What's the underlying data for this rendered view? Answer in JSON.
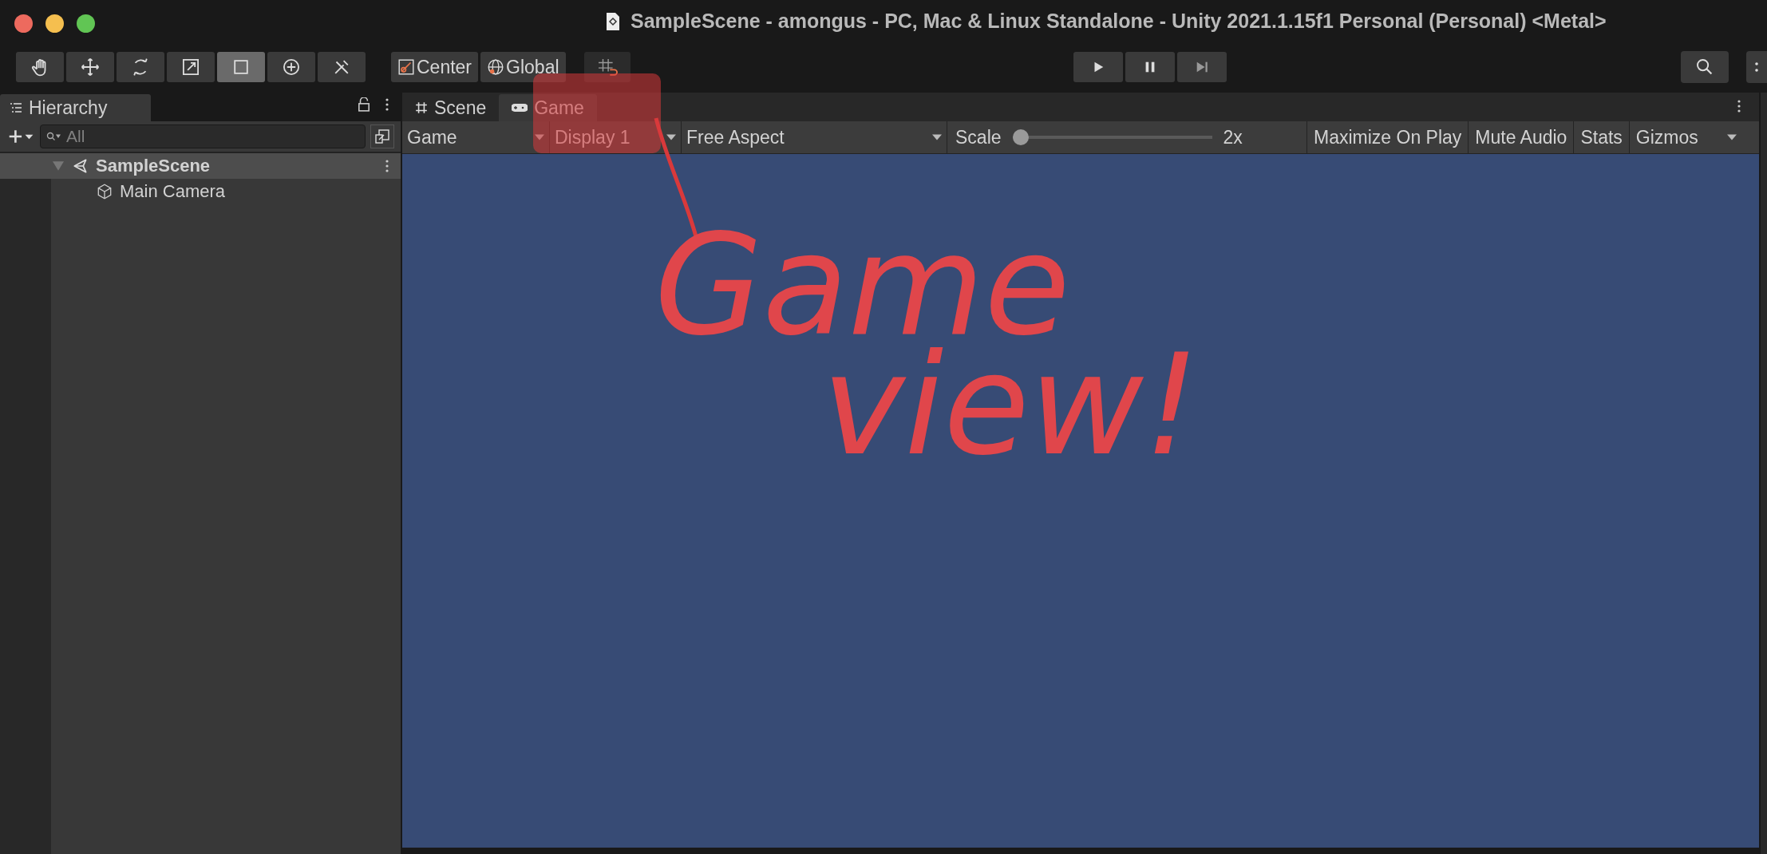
{
  "window": {
    "title": "SampleScene - amongus - PC, Mac & Linux Standalone - Unity 2021.1.15f1 Personal (Personal) <Metal>"
  },
  "tools": [
    {
      "kind": "hand",
      "selected": false
    },
    {
      "kind": "move",
      "selected": false
    },
    {
      "kind": "rotate",
      "selected": false
    },
    {
      "kind": "scale",
      "selected": false
    },
    {
      "kind": "rect",
      "selected": true
    },
    {
      "kind": "transform",
      "selected": false
    },
    {
      "kind": "custom",
      "selected": false
    }
  ],
  "pivot_buttons": [
    {
      "kind": "pivot",
      "label": "Center"
    },
    {
      "kind": "space",
      "label": "Global"
    }
  ],
  "hierarchy": {
    "tab": "Hierarchy",
    "search": {
      "placeholder": "All"
    },
    "tree": [
      {
        "label": "SampleScene",
        "kind": "scene",
        "expanded": true,
        "children": [
          {
            "label": "Main Camera",
            "kind": "object"
          }
        ]
      }
    ]
  },
  "view_tabs": [
    {
      "kind": "scene",
      "label": "Scene",
      "selected": false
    },
    {
      "kind": "game",
      "label": "Game",
      "selected": true
    }
  ],
  "game_toolbar": {
    "view_dropdown": "Game",
    "display_dropdown": "Display 1",
    "aspect_dropdown": "Free Aspect",
    "scale_label": "Scale",
    "scale_slider": {
      "level": 0.0
    },
    "scale_value": "2x",
    "toggles": [
      {
        "label": "Maximize On Play",
        "on": false
      },
      {
        "label": "Mute Audio",
        "on": false
      },
      {
        "label": "Stats",
        "on": false
      }
    ],
    "gizmos": "Gizmos"
  },
  "annotation": {
    "lines": [
      "Game",
      "view!"
    ]
  }
}
